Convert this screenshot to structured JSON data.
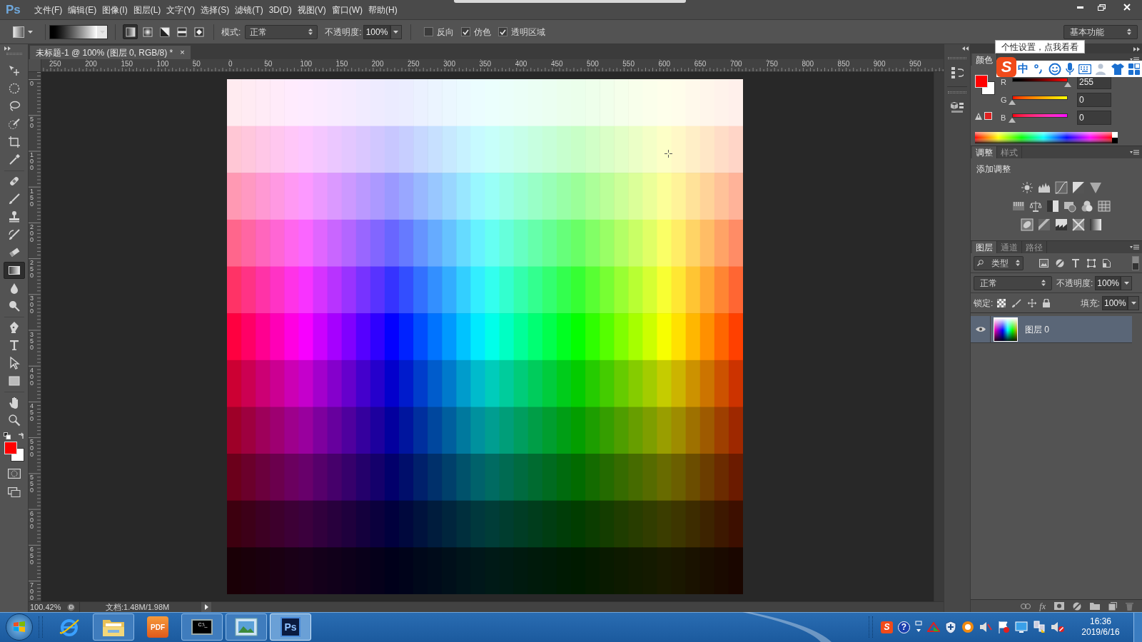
{
  "menu_bar": {
    "logo": "Ps",
    "items": [
      "文件(F)",
      "编辑(E)",
      "图像(I)",
      "图层(L)",
      "文字(Y)",
      "选择(S)",
      "滤镜(T)",
      "3D(D)",
      "视图(V)",
      "窗口(W)",
      "帮助(H)"
    ]
  },
  "options_bar": {
    "gradient_types": [
      {
        "kind": "linear",
        "selected": true
      },
      {
        "kind": "radial",
        "selected": false
      },
      {
        "kind": "angle",
        "selected": false
      },
      {
        "kind": "reflected",
        "selected": false
      },
      {
        "kind": "diamond",
        "selected": false
      }
    ],
    "mode_label": "模式:",
    "mode": "正常",
    "opacity_label": "不透明度:",
    "opacity": "100%",
    "options": [
      {
        "label": "反向",
        "checked": false
      },
      {
        "label": "仿色",
        "checked": true
      },
      {
        "label": "透明区域",
        "checked": true
      }
    ],
    "workspace": "基本功能"
  },
  "document_tab": {
    "title": "未标题-1 @ 100% (图层 0, RGB/8) *",
    "close": "×"
  },
  "rulers": {
    "horizontal": [
      "250",
      "200",
      "150",
      "100",
      "50",
      "0",
      "50",
      "100",
      "150",
      "200",
      "250",
      "300",
      "350",
      "400",
      "450",
      "500",
      "550",
      "600",
      "650",
      "700",
      "750",
      "800",
      "850",
      "900",
      "950"
    ],
    "vertical": [
      "0",
      "50",
      "100",
      "150",
      "200",
      "250",
      "300",
      "350",
      "400",
      "450",
      "500",
      "550",
      "600",
      "650",
      "700"
    ]
  },
  "tools": [
    {
      "kind": "move",
      "selected": false
    },
    {
      "kind": "marquee",
      "selected": false
    },
    {
      "kind": "lasso",
      "selected": false
    },
    {
      "kind": "quickselect",
      "selected": false
    },
    {
      "kind": "crop",
      "selected": false
    },
    {
      "kind": "eyedropper",
      "selected": false
    },
    {
      "kind": "healing",
      "selected": false
    },
    {
      "kind": "brush",
      "selected": false
    },
    {
      "kind": "stamp",
      "selected": false
    },
    {
      "kind": "historybrush",
      "selected": false
    },
    {
      "kind": "eraser",
      "selected": false
    },
    {
      "kind": "gradient",
      "selected": true
    },
    {
      "kind": "blur",
      "selected": false
    },
    {
      "kind": "dodge",
      "selected": false
    },
    {
      "kind": "pen",
      "selected": false
    },
    {
      "kind": "type",
      "selected": false
    },
    {
      "kind": "pathselect",
      "selected": false
    },
    {
      "kind": "rectangle",
      "selected": false
    },
    {
      "kind": "hand",
      "selected": false
    },
    {
      "kind": "zoom",
      "selected": false
    }
  ],
  "status_bar": {
    "zoom": "100.42%",
    "document": "文档:1.48M/1.98M"
  },
  "tooltip": "个性设置，点我看看",
  "ime_toolbar": {
    "logo": "S",
    "mode": "中"
  },
  "color_panel": {
    "tabs": [
      {
        "label": "颜色",
        "selected": true
      }
    ],
    "channels": [
      {
        "label": "R",
        "level": 1,
        "value": "255"
      },
      {
        "label": "G",
        "level": 0,
        "value": "0"
      },
      {
        "label": "B",
        "level": 0,
        "value": "0"
      }
    ]
  },
  "adjustments_panel": {
    "tabs": [
      {
        "label": "调整",
        "selected": true
      },
      {
        "label": "样式",
        "selected": false
      }
    ],
    "heading": "添加调整"
  },
  "layers_panel": {
    "tabs": [
      {
        "label": "图层",
        "selected": true
      },
      {
        "label": "通道",
        "selected": false
      },
      {
        "label": "路径",
        "selected": false
      }
    ],
    "filter": "类型",
    "blend_mode": "正常",
    "opacity_label": "不透明度:",
    "opacity": "100%",
    "lock_label": "锁定:",
    "fill_label": "填充:",
    "fill": "100%",
    "layers": [
      {
        "name": "图层 0",
        "visible": true,
        "selected": true
      }
    ],
    "footer_fx": "fx"
  },
  "taskbar": {
    "apps": [
      {
        "kind": "browser",
        "running": false,
        "selected": false
      },
      {
        "kind": "folder",
        "running": true,
        "selected": false
      },
      {
        "kind": "pdf",
        "label": "PDF",
        "running": false,
        "selected": false
      },
      {
        "kind": "terminal",
        "label": "C:\\_",
        "running": true,
        "selected": false
      },
      {
        "kind": "photo",
        "running": true,
        "selected": false
      },
      {
        "kind": "photoshop",
        "label": "Ps",
        "running": true,
        "selected": true
      }
    ],
    "tray": [
      {
        "kind": "sogou",
        "label": "S"
      },
      {
        "kind": "help",
        "label": "?"
      },
      {
        "kind": "expand"
      },
      {
        "kind": "arrow"
      },
      {
        "kind": "shield"
      },
      {
        "kind": "gear"
      },
      {
        "kind": "speaker"
      },
      {
        "kind": "flag"
      },
      {
        "kind": "display"
      },
      {
        "kind": "network"
      },
      {
        "kind": "mute"
      }
    ],
    "clock": {
      "time": "16:36",
      "date": "2019/6/16"
    }
  }
}
